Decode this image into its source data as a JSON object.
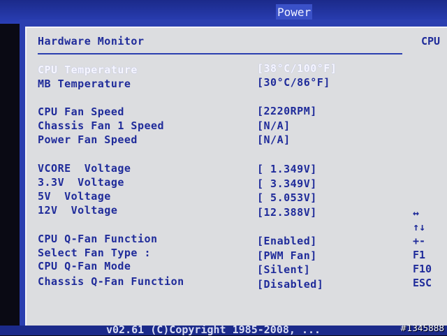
{
  "header": {
    "partial_text": "▀▀▀▀ ▀▀▀▀▀ ▀▀▀▀▀▀",
    "active_tab": "Power"
  },
  "panel": {
    "title": "Hardware Monitor",
    "rows": [
      {
        "label": "CPU Temperature",
        "value": "[38°C/100°F]"
      },
      {
        "label": "MB Temperature",
        "value": "[30°C/86°F]"
      },
      {
        "label": "CPU Fan Speed",
        "value": "[2220RPM]"
      },
      {
        "label": "Chassis Fan 1 Speed",
        "value": "[N/A]"
      },
      {
        "label": "Power Fan Speed",
        "value": "[N/A]"
      },
      {
        "label": "VCORE  Voltage",
        "value": "[ 1.349V]"
      },
      {
        "label": "3.3V  Voltage",
        "value": "[ 3.349V]"
      },
      {
        "label": "5V  Voltage",
        "value": "[ 5.053V]"
      },
      {
        "label": "12V  Voltage",
        "value": "[12.388V]"
      },
      {
        "label": "CPU Q-Fan Function",
        "value": "[Enabled]"
      },
      {
        "label": "Select Fan Type :",
        "value": "[PWM Fan]"
      },
      {
        "label": "CPU Q-Fan Mode",
        "value": "[Silent]"
      },
      {
        "label": "Chassis Q-Fan Function",
        "value": "[Disabled]"
      }
    ]
  },
  "sidebar": {
    "title": "CPU",
    "keys": [
      "↔",
      "↑↓",
      "+-",
      "F1",
      "F10",
      "ESC"
    ]
  },
  "footer": {
    "version": "v02.61 (C)Copyright 1985-2008, ..."
  },
  "watermark": "#1345888",
  "colors": {
    "panel_bg": "#dcdde0",
    "text_blue": "#1f2b9a",
    "frame_blue": "#2b3fb0",
    "selected_text": "#f7f7ff"
  }
}
